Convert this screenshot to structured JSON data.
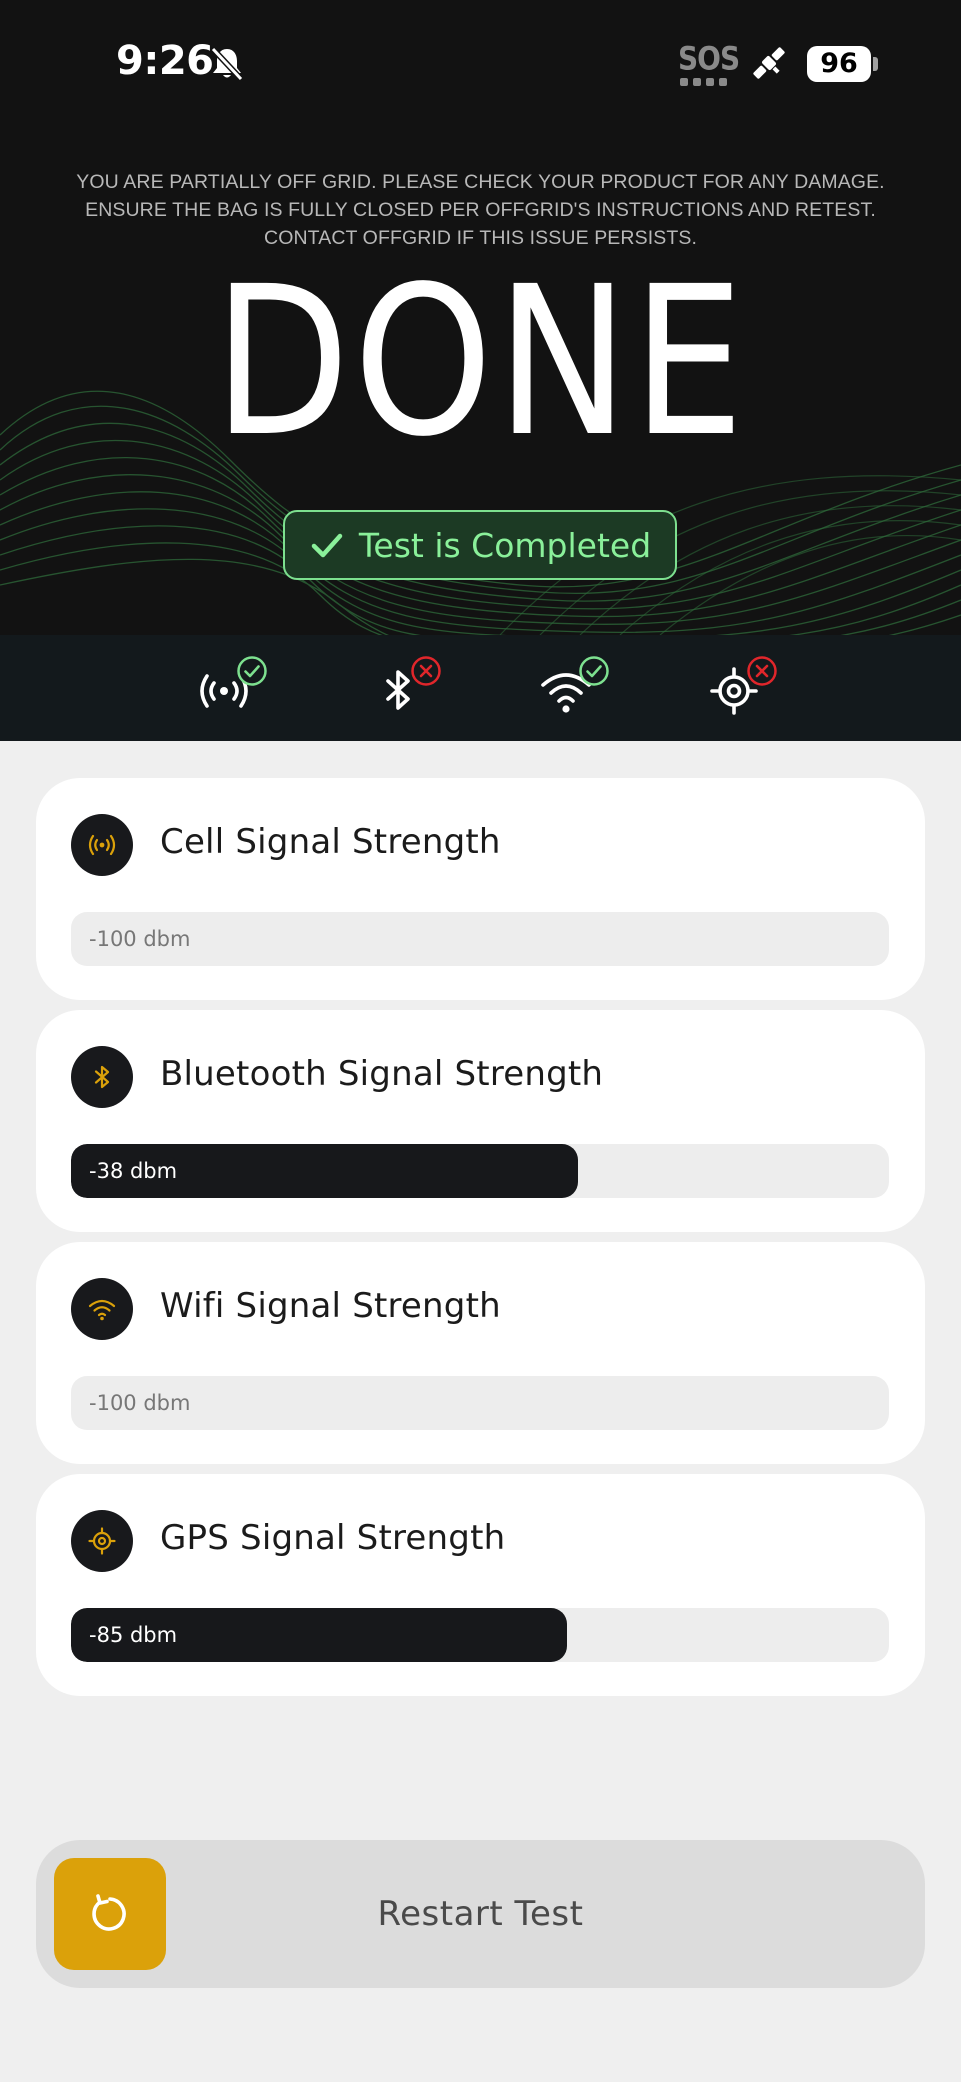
{
  "status_bar": {
    "time": "9:26",
    "sos_label": "SOS",
    "battery": "96"
  },
  "header": {
    "warning_lines": [
      "YOU ARE PARTIALLY OFF GRID. PLEASE CHECK YOUR PRODUCT FOR ANY DAMAGE.",
      "ENSURE THE BAG IS FULLY CLOSED PER OFFGRID'S INSTRUCTIONS AND RETEST.",
      "CONTACT OFFGRID IF THIS ISSUE PERSISTS."
    ],
    "title": "DONE",
    "completed_label": "Test is Completed"
  },
  "icon_strip": [
    {
      "icon": "cell-signal-icon",
      "status": "pass"
    },
    {
      "icon": "bluetooth-icon",
      "status": "fail"
    },
    {
      "icon": "wifi-icon",
      "status": "pass"
    },
    {
      "icon": "gps-icon",
      "status": "fail"
    }
  ],
  "signals": [
    {
      "icon": "cell-signal-icon",
      "title": "Cell Signal Strength",
      "value": "-100 dbm",
      "fill_fraction": 0.0
    },
    {
      "icon": "bluetooth-icon",
      "title": "Bluetooth Signal Strength",
      "value": "-38 dbm",
      "fill_fraction": 0.62
    },
    {
      "icon": "wifi-icon",
      "title": "Wifi Signal Strength",
      "value": "-100 dbm",
      "fill_fraction": 0.0
    },
    {
      "icon": "gps-icon",
      "title": "GPS Signal Strength",
      "value": "-85 dbm",
      "fill_fraction": 0.606
    }
  ],
  "restart": {
    "label": "Restart Test",
    "icon": "refresh-icon"
  },
  "colors": {
    "accent_gold": "#dba10a",
    "pass_green": "#7de08f",
    "fail_red": "#e0262b",
    "dark": "#121212",
    "card_bg": "#ffffff",
    "page_bg": "#efefef"
  }
}
